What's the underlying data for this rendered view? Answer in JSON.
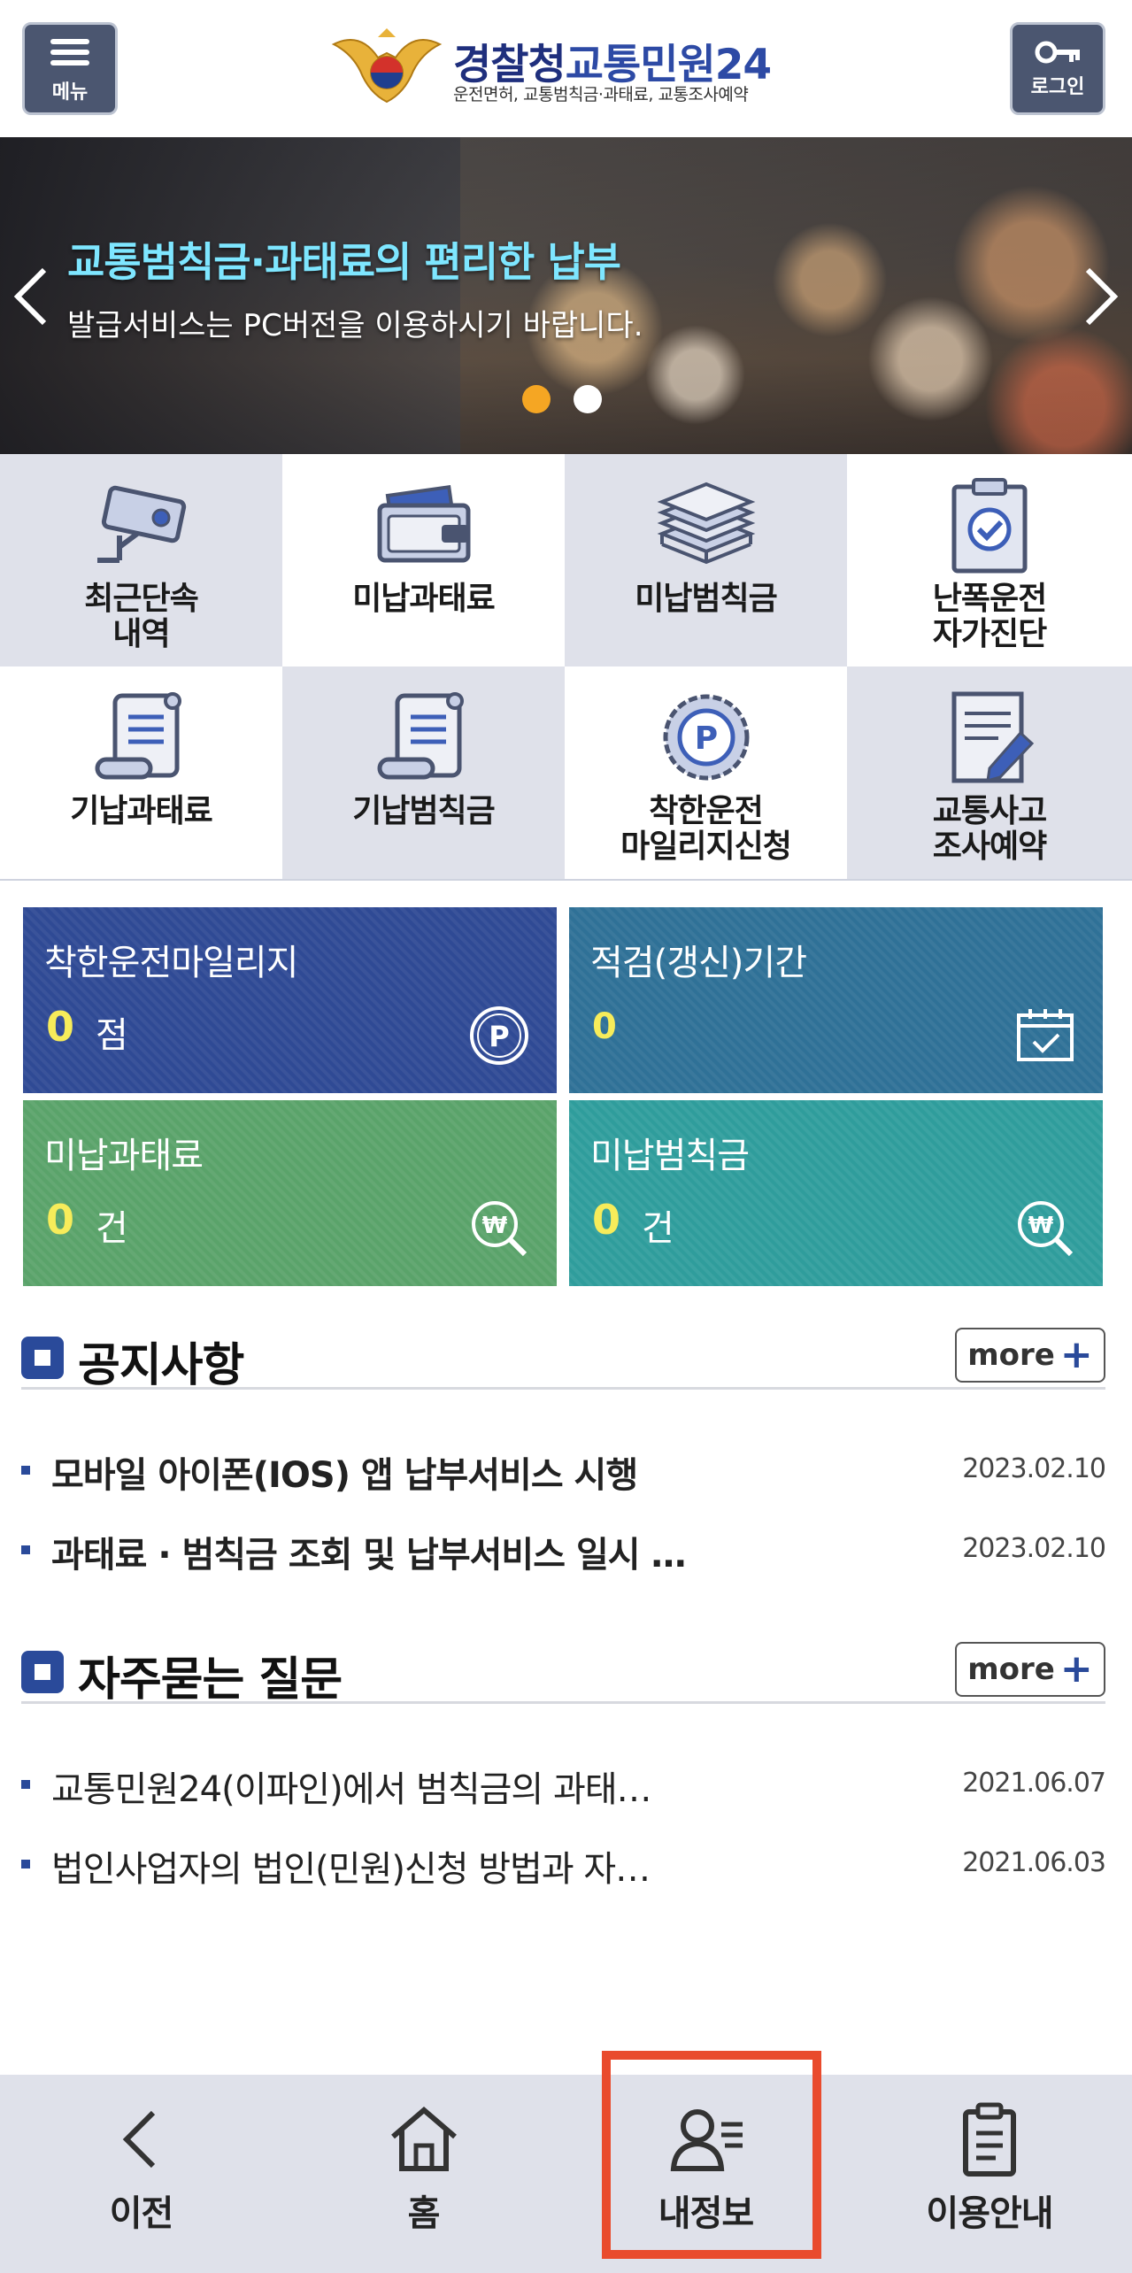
{
  "header": {
    "menu_label": "메뉴",
    "login_label": "로그인",
    "logo_title_1": "경찰청",
    "logo_title_2": "교통민원24",
    "logo_subtitle": "운전면허, 교통범칙금·과태료, 교통조사예약"
  },
  "banner": {
    "headline": "교통범칙금·과태료의 편리한 납부",
    "subline": "발급서비스는 PC버전을 이용하시기 바랍니다.",
    "active_dot": 1,
    "dot_count": 2
  },
  "grid": [
    {
      "label": "최근단속\n내역",
      "icon": "cctv-camera-icon"
    },
    {
      "label": "미납과태료",
      "icon": "wallet-icon"
    },
    {
      "label": "미납범칙금",
      "icon": "money-stack-icon"
    },
    {
      "label": "난폭운전\n자가진단",
      "icon": "clipboard-check-icon"
    },
    {
      "label": "기납과태료",
      "icon": "scroll-document-icon"
    },
    {
      "label": "기납범칙금",
      "icon": "scroll-document-icon"
    },
    {
      "label": "착한운전\n마일리지신청",
      "icon": "mileage-coin-icon"
    },
    {
      "label": "교통사고\n조사예약",
      "icon": "document-pen-icon"
    }
  ],
  "tiles": {
    "mileage": {
      "title": "착한운전마일리지",
      "value": "0",
      "unit": "점",
      "icon": "points-icon"
    },
    "inspection": {
      "title": "적검(갱신)기간",
      "value": "0",
      "unit": "",
      "icon": "calendar-check-icon"
    },
    "fines": {
      "title": "미납과태료",
      "value": "0",
      "unit": "건",
      "icon": "won-search-icon"
    },
    "penalties": {
      "title": "미납범칙금",
      "value": "0",
      "unit": "건",
      "icon": "won-search-icon"
    }
  },
  "notices": {
    "title": "공지사항",
    "more": "more",
    "items": [
      {
        "text": "모바일 아이폰(IOS) 앱 납부서비스 시행",
        "date": "2023.02.10"
      },
      {
        "text": "과태료 · 범칙금 조회 및 납부서비스 일시 …",
        "date": "2023.02.10"
      }
    ]
  },
  "faq": {
    "title": "자주묻는 질문",
    "more": "more",
    "items": [
      {
        "text": "교통민원24(이파인)에서 범칙금의 과태…",
        "date": "2021.06.07"
      },
      {
        "text": "법인사업자의 법인(민원)신청 방법과 자…",
        "date": "2021.06.03"
      }
    ]
  },
  "bottom_nav": {
    "back": "이전",
    "home": "홈",
    "myinfo": "내정보",
    "guide": "이용안내"
  },
  "colors": {
    "brand_navy": "#2a4a9a",
    "highlight": "#e94b2d",
    "value_yellow": "#f7ec5a"
  }
}
